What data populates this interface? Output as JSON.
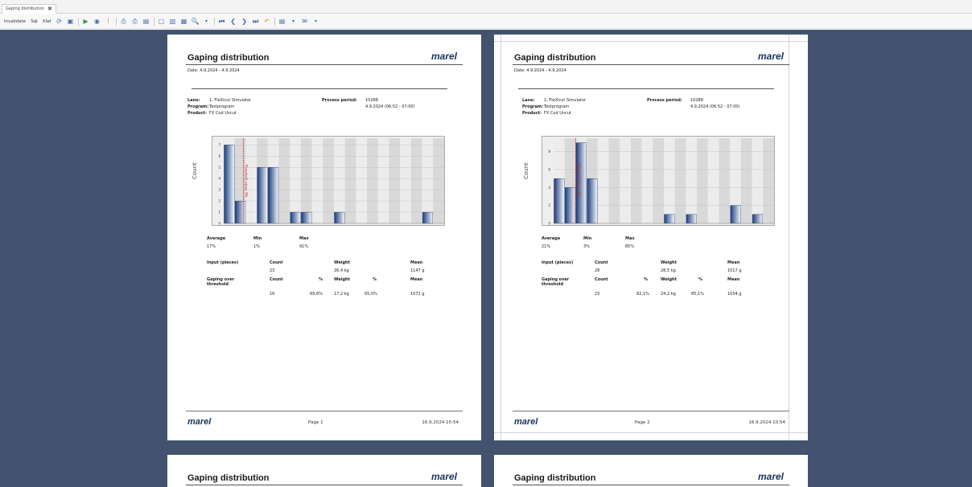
{
  "tab": {
    "title": "Gaping distribution",
    "close": "✖"
  },
  "toolbar": {
    "items": [
      "Invalidate",
      "Sql",
      "Xlat"
    ]
  },
  "pages": [
    {
      "title": "Gaping distribution",
      "logo": "marel",
      "date": "Date: 4.9.2024 - 4.9.2024",
      "lane_label": "Lane:",
      "lane": "1, FleXicut Simulator",
      "program_label": "Program:",
      "program": "Testprogram",
      "product_label": "Product:",
      "product": "FX Cod Uncut",
      "period_label": "Process period:",
      "period_id": "10288",
      "period": "4.9.2024 (06:52 - 07:00)",
      "ylabel": "Count",
      "threshold_label": "Threshold value: 9%",
      "stats": {
        "avg_h": "Average",
        "min_h": "Min",
        "max_h": "Max",
        "avg": "17%",
        "min": "1%",
        "max": "91%"
      },
      "input": {
        "label": "Input (pieces)",
        "count_h": "Count",
        "weight_h": "Weight",
        "mean_h": "Mean",
        "count": "23",
        "weight": "26,4 kg",
        "mean": "1147 g"
      },
      "gaping": {
        "label": "Gaping over threshold",
        "count_h": "Count",
        "pct_h": "%",
        "weight_h": "Weight",
        "pct2_h": "%",
        "mean_h": "Mean",
        "count": "16",
        "pct": "69,6%",
        "weight": "17,2 kg",
        "pct2": "65,0%",
        "mean": "1072 g"
      },
      "footer_page": "Page 1",
      "footer_date": "16.9.2024 10:54"
    },
    {
      "title": "Gaping distribution",
      "logo": "marel",
      "date": "Date: 4.9.2024 - 4.9.2024",
      "lane_label": "Lane:",
      "lane": "1, FleXicut Simulator",
      "program_label": "Program:",
      "program": "Testprogram",
      "product_label": "Product:",
      "product": "FX Cod Uncut",
      "period_label": "Process period:",
      "period_id": "10288",
      "period": "4.9.2024 (06:52 - 07:00)",
      "ylabel": "Count",
      "threshold_label": "Threshold value: 10%",
      "stats": {
        "avg_h": "Average",
        "min_h": "Min",
        "max_h": "Max",
        "avg": "21%",
        "min": "3%",
        "max": "85%"
      },
      "input": {
        "label": "Input (pieces)",
        "count_h": "Count",
        "weight_h": "Weight",
        "mean_h": "Mean",
        "count": "28",
        "weight": "28,5 kg",
        "mean": "1017 g"
      },
      "gaping": {
        "label": "Gaping over threshold",
        "count_h": "Count",
        "pct_h": "%",
        "weight_h": "Weight",
        "pct2_h": "%",
        "mean_h": "Mean",
        "count": "23",
        "pct": "82,1%",
        "weight": "24,2 kg",
        "pct2": "85,1%",
        "mean": "1054 g"
      },
      "footer_page": "Page 2",
      "footer_date": "16.9.2024 10:54"
    },
    {
      "title": "Gaping distribution",
      "logo": "marel"
    },
    {
      "title": "Gaping distribution",
      "logo": "marel"
    }
  ],
  "chart_data": [
    {
      "type": "bar",
      "ylabel": "Count",
      "ylim": [
        0,
        7.6
      ],
      "yticks": [
        0,
        1,
        2,
        3,
        4,
        5,
        6,
        7
      ],
      "values": [
        7,
        2,
        0,
        5,
        5,
        0,
        1,
        1,
        0,
        0,
        1,
        0,
        0,
        0,
        0,
        0,
        0,
        0,
        1,
        0
      ],
      "threshold": 9
    },
    {
      "type": "bar",
      "ylabel": "Count",
      "ylim": [
        0,
        9.5
      ],
      "yticks": [
        0,
        2,
        4,
        6,
        8
      ],
      "values": [
        5,
        4,
        9,
        5,
        0,
        0,
        0,
        0,
        0,
        0,
        1,
        0,
        1,
        0,
        0,
        0,
        2,
        0,
        1,
        0
      ],
      "threshold": 10
    }
  ]
}
